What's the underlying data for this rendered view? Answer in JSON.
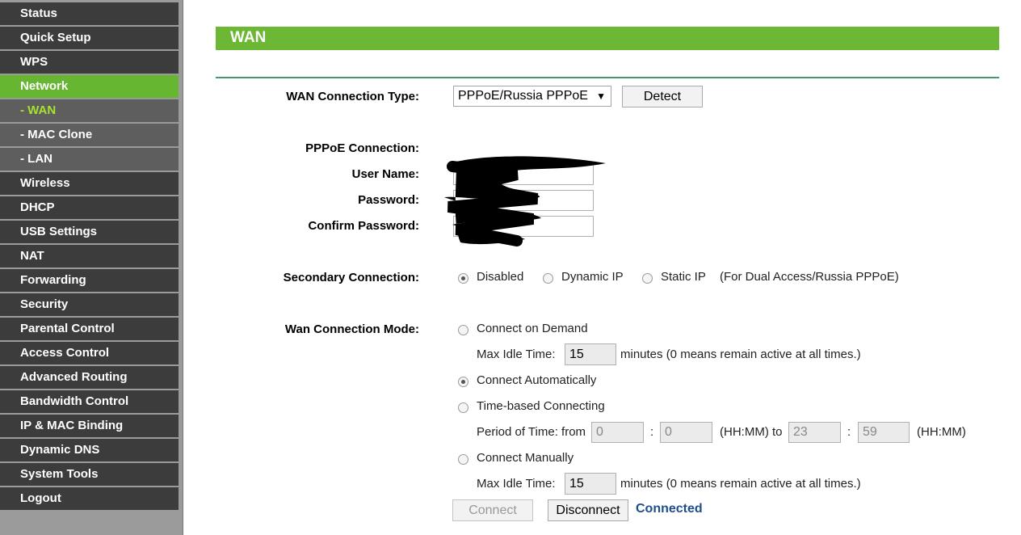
{
  "sidebar": {
    "items": [
      {
        "label": "Status"
      },
      {
        "label": "Quick Setup"
      },
      {
        "label": "WPS"
      },
      {
        "label": "Network"
      },
      {
        "label": "- WAN"
      },
      {
        "label": "- MAC Clone"
      },
      {
        "label": "- LAN"
      },
      {
        "label": "Wireless"
      },
      {
        "label": "DHCP"
      },
      {
        "label": "USB Settings"
      },
      {
        "label": "NAT"
      },
      {
        "label": "Forwarding"
      },
      {
        "label": "Security"
      },
      {
        "label": "Parental Control"
      },
      {
        "label": "Access Control"
      },
      {
        "label": "Advanced Routing"
      },
      {
        "label": "Bandwidth Control"
      },
      {
        "label": "IP & MAC Binding"
      },
      {
        "label": "Dynamic DNS"
      },
      {
        "label": "System Tools"
      },
      {
        "label": "Logout"
      }
    ]
  },
  "header": {
    "title": "WAN"
  },
  "wan_type": {
    "label": "WAN Connection Type:",
    "selected": "PPPoE/Russia PPPoE",
    "detect_label": "Detect"
  },
  "pppoe": {
    "section_label": "PPPoE Connection:",
    "user_label": "User Name:",
    "password_label": "Password:",
    "confirm_label": "Confirm Password:"
  },
  "secondary": {
    "label": "Secondary Connection:",
    "options": [
      "Disabled",
      "Dynamic IP",
      "Static IP"
    ],
    "note": "(For Dual Access/Russia PPPoE)"
  },
  "mode": {
    "label": "Wan Connection Mode:",
    "on_demand": "Connect on Demand",
    "max_idle_label": "Max Idle Time:",
    "idle_value_1": "15",
    "idle_note": "minutes (0 means remain active at all times.)",
    "automatic": "Connect Automatically",
    "time_based": "Time-based Connecting",
    "period_label": "Period of Time: from",
    "from_hh": "0",
    "from_mm": "0",
    "hhmm_to": "(HH:MM) to",
    "to_hh": "23",
    "to_mm": "59",
    "hhmm": "(HH:MM)",
    "colon": ":",
    "manual": "Connect Manually",
    "idle_value_2": "15"
  },
  "actions": {
    "connect_label": "Connect",
    "disconnect_label": "Disconnect",
    "status": "Connected"
  },
  "colors": {
    "accent_green": "#6cb733",
    "sidebar_dark": "#3c3c3c",
    "status_blue": "#1f4e8c"
  }
}
